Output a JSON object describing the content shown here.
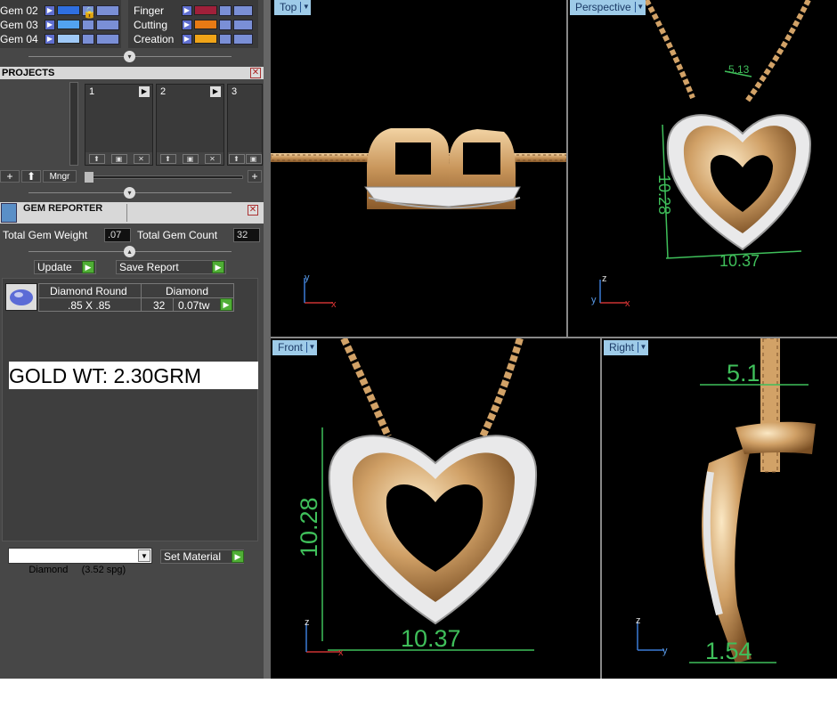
{
  "materials": {
    "left": [
      {
        "label": "Gem 02",
        "color": "#2f6fe0"
      },
      {
        "label": "Gem 03",
        "color": "#52a3f0"
      },
      {
        "label": "Gem 04",
        "color": "#9fc9f7"
      }
    ],
    "right": [
      {
        "label": "Finger",
        "color": "#a0203a"
      },
      {
        "label": "Cutting",
        "color": "#e87a14"
      },
      {
        "label": "Creation",
        "color": "#f0a418"
      }
    ]
  },
  "projects": {
    "title": "PROJECTS",
    "slots": [
      "1",
      "2",
      "3"
    ],
    "mngr_label": "Mngr"
  },
  "gem_reporter": {
    "title": "GEM REPORTER",
    "total_weight_label": "Total Gem Weight",
    "total_weight_value": ".07",
    "total_count_label": "Total Gem Count",
    "total_count_value": "32",
    "update_label": "Update",
    "save_label": "Save Report",
    "gem": {
      "shape": "Diamond Round",
      "size": ".85 X .85",
      "material": "Diamond",
      "count": "32",
      "weight": "0.07tw"
    },
    "gold_weight_text": "GOLD WT: 2.30GRM",
    "material_select": "Diamond     (3.52 spg)",
    "set_material_label": "Set Material"
  },
  "viewports": {
    "top": {
      "title": "Top",
      "axis_a": "y",
      "axis_b": "x"
    },
    "perspective": {
      "title": "Perspective",
      "axis_a": "z",
      "axis_b": "y",
      "axis_c": "x",
      "dim_width": "10.37",
      "dim_height": "10.28",
      "dim_top": "5.13"
    },
    "front": {
      "title": "Front",
      "axis_a": "z",
      "axis_b": "x",
      "dim_width": "10.37",
      "dim_height": "10.28"
    },
    "right": {
      "title": "Right",
      "axis_a": "z",
      "axis_b": "y",
      "dim_top": "5.1",
      "dim_bottom": "1.54"
    }
  },
  "colors": {
    "gold": "#d2a267",
    "dimension": "#3fbf5a",
    "viewport_tab": "#9ecbe8"
  }
}
